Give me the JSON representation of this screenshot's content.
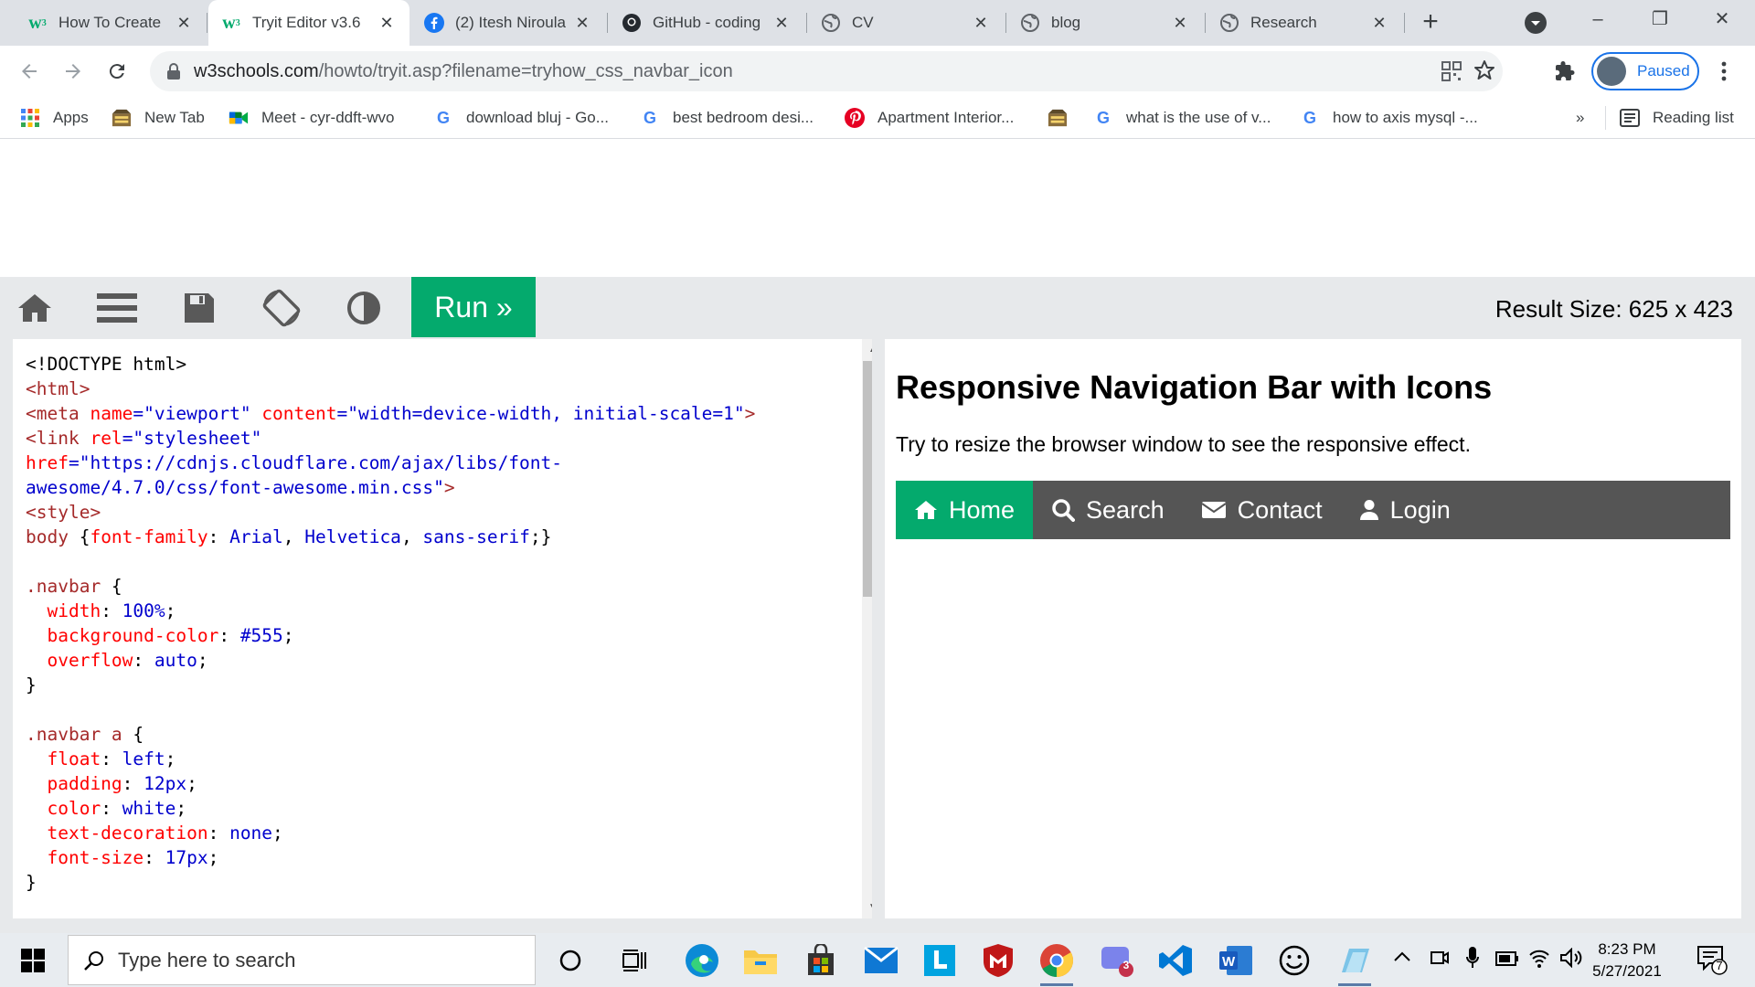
{
  "browser": {
    "tabs": [
      {
        "title": "How To Create",
        "icon": "w3schools-icon",
        "active": false
      },
      {
        "title": "Tryit Editor v3.6",
        "icon": "w3schools-icon",
        "active": true
      },
      {
        "title": "(2) Itesh Niroula",
        "icon": "facebook-icon",
        "active": false
      },
      {
        "title": "GitHub - coding",
        "icon": "github-icon",
        "active": false
      },
      {
        "title": "CV",
        "icon": "globe-icon",
        "active": false
      },
      {
        "title": "blog",
        "icon": "globe-icon",
        "active": false
      },
      {
        "title": "Research",
        "icon": "globe-icon",
        "active": false
      }
    ],
    "address": {
      "host": "w3schools.com",
      "path": "/howto/tryit.asp?filename=tryhow_css_navbar_icon"
    },
    "profile_label": "Paused",
    "bookmarks": [
      {
        "label": "Apps",
        "icon": "apps-grid-icon"
      },
      {
        "label": "New Tab",
        "icon": "newtab-icon"
      },
      {
        "label": "Meet - cyr-ddft-wvo",
        "icon": "meet-icon"
      },
      {
        "label": "download bluj - Go...",
        "icon": "google-icon"
      },
      {
        "label": "best bedroom desi...",
        "icon": "google-icon"
      },
      {
        "label": "Apartment Interior...",
        "icon": "pinterest-icon"
      },
      {
        "label": "",
        "icon": "newtab-icon"
      },
      {
        "label": "what is the use of v...",
        "icon": "google-icon"
      },
      {
        "label": "how to axis mysql -...",
        "icon": "google-icon"
      }
    ],
    "overflow_label": "»",
    "reading_list_label": "Reading list"
  },
  "editor": {
    "run_label": "Run »",
    "result_size": "Result Size: 625 x 423",
    "code_lines": [
      [
        {
          "t": "<!DOCTYPE html>",
          "c": "c-plain"
        }
      ],
      [
        {
          "t": "<html>",
          "c": "c-tag"
        }
      ],
      [
        {
          "t": "<meta ",
          "c": "c-tag"
        },
        {
          "t": "name",
          "c": "c-attr"
        },
        {
          "t": "=\"viewport\" ",
          "c": "c-val"
        },
        {
          "t": "content",
          "c": "c-attr"
        },
        {
          "t": "=\"width=device-width, initial-scale=1\"",
          "c": "c-val"
        },
        {
          "t": ">",
          "c": "c-tag"
        }
      ],
      [
        {
          "t": "<link ",
          "c": "c-tag"
        },
        {
          "t": "rel",
          "c": "c-attr"
        },
        {
          "t": "=\"stylesheet\"",
          "c": "c-val"
        }
      ],
      [
        {
          "t": "href",
          "c": "c-attr"
        },
        {
          "t": "=\"https://cdnjs.cloudflare.com/ajax/libs/font-",
          "c": "c-val"
        }
      ],
      [
        {
          "t": "awesome/4.7.0/css/font-awesome.min.css\"",
          "c": "c-val"
        },
        {
          "t": ">",
          "c": "c-tag"
        }
      ],
      [
        {
          "t": "<style>",
          "c": "c-tag"
        }
      ],
      [
        {
          "t": "body ",
          "c": "c-sel"
        },
        {
          "t": "{",
          "c": "c-plain"
        },
        {
          "t": "font-family",
          "c": "c-prop"
        },
        {
          "t": ": ",
          "c": "c-plain"
        },
        {
          "t": "Arial",
          "c": "c-val"
        },
        {
          "t": ", ",
          "c": "c-plain"
        },
        {
          "t": "Helvetica",
          "c": "c-val"
        },
        {
          "t": ", ",
          "c": "c-plain"
        },
        {
          "t": "sans-serif",
          "c": "c-val"
        },
        {
          "t": ";}",
          "c": "c-plain"
        }
      ],
      [
        {
          "t": "",
          "c": "c-plain"
        }
      ],
      [
        {
          "t": ".navbar ",
          "c": "c-sel"
        },
        {
          "t": "{",
          "c": "c-plain"
        }
      ],
      [
        {
          "t": "  width",
          "c": "c-prop"
        },
        {
          "t": ": ",
          "c": "c-plain"
        },
        {
          "t": "100%",
          "c": "c-val"
        },
        {
          "t": ";",
          "c": "c-plain"
        }
      ],
      [
        {
          "t": "  background-color",
          "c": "c-prop"
        },
        {
          "t": ": ",
          "c": "c-plain"
        },
        {
          "t": "#555",
          "c": "c-val"
        },
        {
          "t": ";",
          "c": "c-plain"
        }
      ],
      [
        {
          "t": "  overflow",
          "c": "c-prop"
        },
        {
          "t": ": ",
          "c": "c-plain"
        },
        {
          "t": "auto",
          "c": "c-val"
        },
        {
          "t": ";",
          "c": "c-plain"
        }
      ],
      [
        {
          "t": "}",
          "c": "c-plain"
        }
      ],
      [
        {
          "t": "",
          "c": "c-plain"
        }
      ],
      [
        {
          "t": ".navbar a ",
          "c": "c-sel"
        },
        {
          "t": "{",
          "c": "c-plain"
        }
      ],
      [
        {
          "t": "  float",
          "c": "c-prop"
        },
        {
          "t": ": ",
          "c": "c-plain"
        },
        {
          "t": "left",
          "c": "c-val"
        },
        {
          "t": ";",
          "c": "c-plain"
        }
      ],
      [
        {
          "t": "  padding",
          "c": "c-prop"
        },
        {
          "t": ": ",
          "c": "c-plain"
        },
        {
          "t": "12px",
          "c": "c-val"
        },
        {
          "t": ";",
          "c": "c-plain"
        }
      ],
      [
        {
          "t": "  color",
          "c": "c-prop"
        },
        {
          "t": ": ",
          "c": "c-plain"
        },
        {
          "t": "white",
          "c": "c-val"
        },
        {
          "t": ";",
          "c": "c-plain"
        }
      ],
      [
        {
          "t": "  text-decoration",
          "c": "c-prop"
        },
        {
          "t": ": ",
          "c": "c-plain"
        },
        {
          "t": "none",
          "c": "c-val"
        },
        {
          "t": ";",
          "c": "c-plain"
        }
      ],
      [
        {
          "t": "  font-size",
          "c": "c-prop"
        },
        {
          "t": ": ",
          "c": "c-plain"
        },
        {
          "t": "17px",
          "c": "c-val"
        },
        {
          "t": ";",
          "c": "c-plain"
        }
      ],
      [
        {
          "t": "}",
          "c": "c-plain"
        }
      ]
    ]
  },
  "result": {
    "title": "Responsive Navigation Bar with Icons",
    "description": "Try to resize the browser window to see the responsive effect.",
    "nav": [
      {
        "label": "Home",
        "icon": "home-icon",
        "active": true
      },
      {
        "label": "Search",
        "icon": "search-icon",
        "active": false
      },
      {
        "label": "Contact",
        "icon": "envelope-icon",
        "active": false
      },
      {
        "label": "Login",
        "icon": "user-icon",
        "active": false
      }
    ]
  },
  "taskbar": {
    "search_placeholder": "Type here to search",
    "time": "8:23 PM",
    "date": "5/27/2021",
    "notification_count": "7",
    "chat_badge": "3"
  },
  "colors": {
    "w3_green": "#04aa6d",
    "navbar_bg": "#555555",
    "chrome_blue": "#1a73e8"
  }
}
